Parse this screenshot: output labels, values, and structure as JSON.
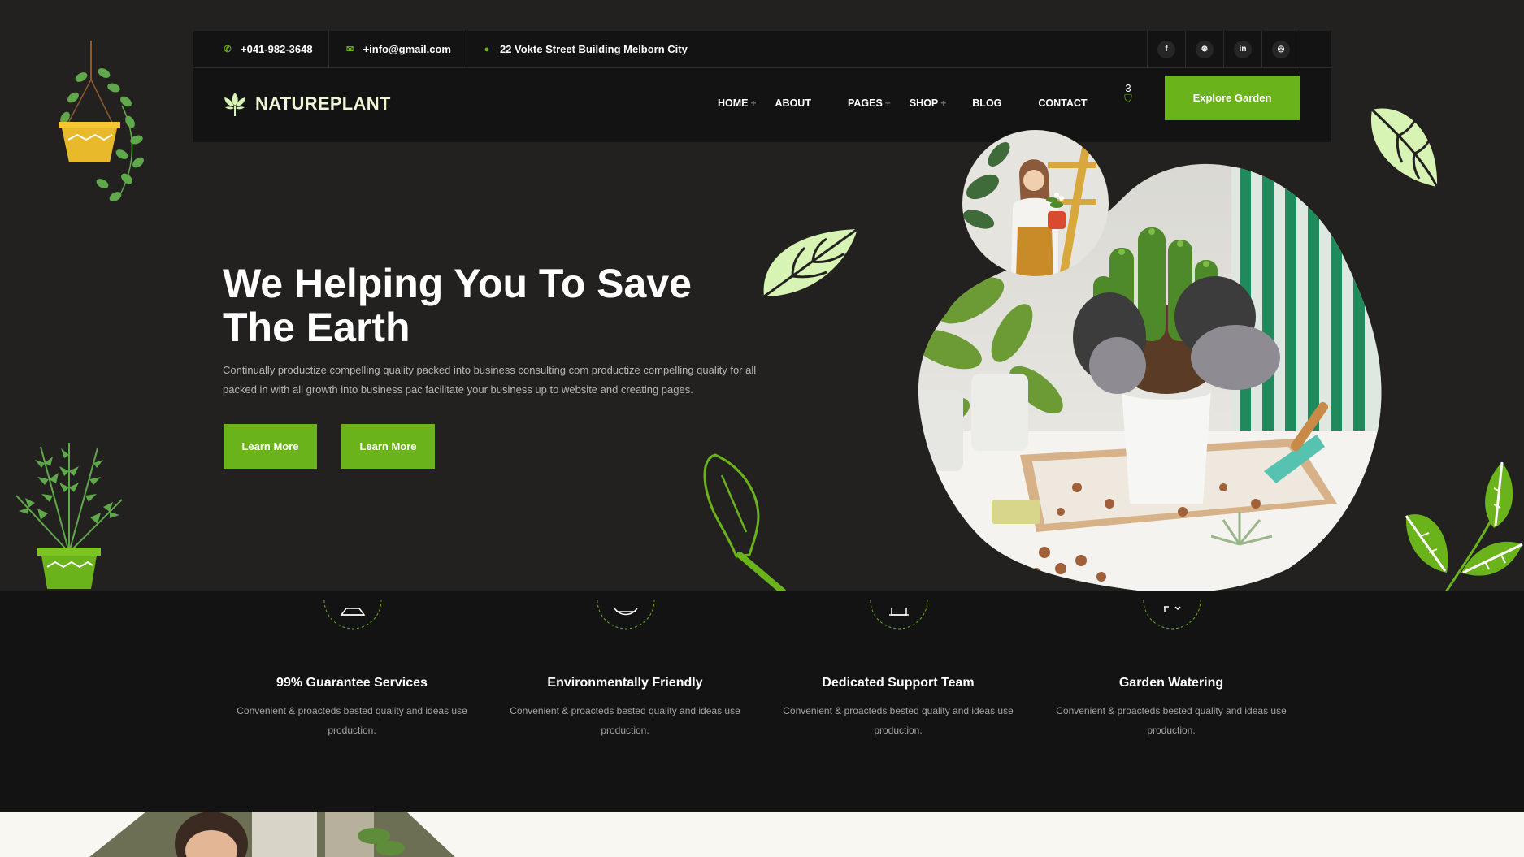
{
  "topbar": {
    "phone": "+041-982-3648",
    "email": "+info@gmail.com",
    "address": "22 Vokte Street Building Melborn City",
    "social": [
      {
        "icon": "facebook-icon",
        "glyph": "f"
      },
      {
        "icon": "dribbble-icon",
        "glyph": "⊛"
      },
      {
        "icon": "linkedin-icon",
        "glyph": "in"
      },
      {
        "icon": "instagram-icon",
        "glyph": "◎"
      }
    ]
  },
  "brand": {
    "name": "NATUREPLANT"
  },
  "nav": {
    "items": [
      {
        "label": "HOME",
        "has_sub": true
      },
      {
        "label": "ABOUT",
        "has_sub": false
      },
      {
        "label": "PAGES",
        "has_sub": true
      },
      {
        "label": "SHOP",
        "has_sub": true
      },
      {
        "label": "BLOG",
        "has_sub": false
      },
      {
        "label": "CONTACT",
        "has_sub": false
      }
    ],
    "cart_count": "3",
    "cta": "Explore Garden"
  },
  "hero": {
    "title": "We Helping You To Save The Earth",
    "description": "Continually productize compelling quality packed into business consulting com productize compelling quality for all packed in with all growth into business pac facilitate your business up to website and creating pages.",
    "button1": "Learn More",
    "button2": "Learn More"
  },
  "features": [
    {
      "title": "99% Guarantee Services",
      "desc": "Convenient & proacteds bested quality and ideas use production."
    },
    {
      "title": "Environmentally Friendly",
      "desc": "Convenient & proacteds bested quality and ideas use production."
    },
    {
      "title": "Dedicated Support Team",
      "desc": "Convenient & proacteds bested quality and ideas use production."
    },
    {
      "title": "Garden Watering",
      "desc": "Convenient & proacteds bested quality and ideas use production."
    }
  ],
  "colors": {
    "accent": "#6bb31a",
    "background": "#23211f",
    "header": "#131313",
    "leaf_light": "#d8f4b4"
  }
}
